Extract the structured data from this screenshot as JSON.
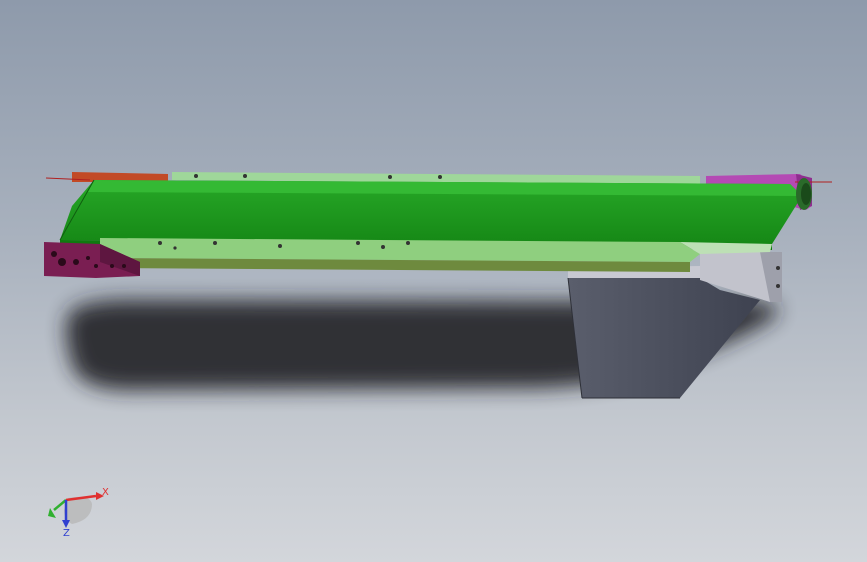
{
  "window": {
    "view": "3d-model-viewport"
  },
  "triad": {
    "x_label": "X",
    "z_label": "Z",
    "x_color": "#e03030",
    "z_color": "#3040d0",
    "y_color": "#30b030"
  },
  "colors": {
    "belt": "#1f9a1f",
    "belt_top": "#2ab02a",
    "frame_side": "#8fcf7f",
    "end_plate_left": "#7a1e52",
    "end_plate_right": "#b048b0",
    "bracket_left": "#c04a2a",
    "support_leg": "#4a4e5c",
    "support_leg_light": "#c8c8d0",
    "shadow": "#2a2a2e"
  }
}
